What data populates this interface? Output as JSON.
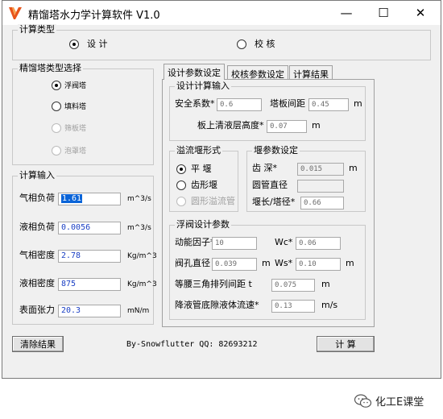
{
  "window": {
    "title": "精馏塔水力学计算软件 V1.0",
    "min_label": "—",
    "max_label": "☐",
    "close_label": "✕"
  },
  "calc_type": {
    "legend": "计算类型",
    "design": "设 计",
    "check": "校 核",
    "selected": "design"
  },
  "tray_type": {
    "legend": "精馏塔类型选择",
    "options": [
      "浮阀塔",
      "填料塔",
      "筛板塔",
      "泡罩塔"
    ],
    "selected": 0
  },
  "input": {
    "legend": "计算输入",
    "rows": [
      {
        "label": "气相负荷",
        "value": "1.61",
        "unit": "m^3/s"
      },
      {
        "label": "液相负荷",
        "value": "0.0056",
        "unit": "m^3/s"
      },
      {
        "label": "气相密度",
        "value": "2.78",
        "unit": "Kg/m^3"
      },
      {
        "label": "液相密度",
        "value": "875",
        "unit": "Kg/m^3"
      },
      {
        "label": "表面张力",
        "value": "20.3",
        "unit": "mN/m"
      }
    ]
  },
  "tabs": [
    "设计参数设定",
    "校核参数设定",
    "计算结果"
  ],
  "design_params": {
    "legend": "设计计算输入",
    "safety_label": "安全系数*",
    "safety_value": "0.6",
    "spacing_label": "塔板间距",
    "spacing_value": "0.45",
    "spacing_unit": "m",
    "clear_label": "板上清液层高度*",
    "clear_value": "0.07",
    "clear_unit": "m"
  },
  "weir_type": {
    "legend": "溢流堰形式",
    "options": [
      "平  堰",
      "齿形堰",
      "圆形溢流管"
    ],
    "selected": 0
  },
  "weir_params": {
    "legend": "堰参数设定",
    "depth_label": "齿  深*",
    "depth_value": "0.015",
    "depth_unit": "m",
    "pipe_label": "圆管直径",
    "pipe_value": "",
    "ratio_label": "堰长/塔径*",
    "ratio_value": "0.66"
  },
  "valve_params": {
    "legend": "浮阀设计参数",
    "factor_label": "动能因子*",
    "factor_value": "10",
    "wc_label": "Wc*",
    "wc_value": "0.06",
    "hole_label": "阀孔直径",
    "hole_value": "0.039",
    "hole_unit": "m",
    "ws_label": "Ws*",
    "ws_value": "0.10",
    "ws_unit": "m",
    "pitch_label": "等腰三角排列间距 t",
    "pitch_value": "0.075",
    "pitch_unit": "m",
    "speed_label": "降液管底隙液体流速*",
    "speed_value": "0.13",
    "speed_unit": "m/s"
  },
  "footer": {
    "clear_button": "清除结果",
    "credit": "By-Snowflutter   QQ: 82693212",
    "calc_button": "计 算"
  },
  "watermark": "化工E课堂",
  "accent_color": "#0a64d8"
}
